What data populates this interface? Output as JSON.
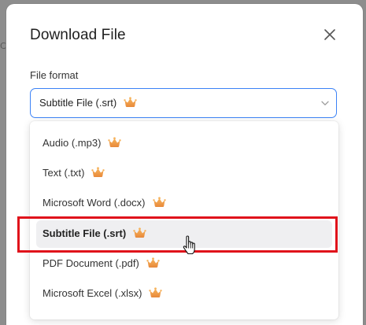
{
  "background": {
    "partial_text": "C"
  },
  "dialog": {
    "title": "Download File",
    "field_label": "File format",
    "selected_value": "Subtitle File (.srt)",
    "options": [
      {
        "label": "Audio (.mp3)",
        "premium": true,
        "selected": false
      },
      {
        "label": "Text (.txt)",
        "premium": true,
        "selected": false
      },
      {
        "label": "Microsoft Word (.docx)",
        "premium": true,
        "selected": false
      },
      {
        "label": "Subtitle File (.srt)",
        "premium": true,
        "selected": true
      },
      {
        "label": "PDF Document (.pdf)",
        "premium": true,
        "selected": false
      },
      {
        "label": "Microsoft Excel (.xlsx)",
        "premium": true,
        "selected": false
      }
    ]
  },
  "icons": {
    "close": "close-icon",
    "dropdown": "chevron-down-icon",
    "premium": "crown-icon",
    "cursor": "hand-pointer-cursor"
  },
  "colors": {
    "select_border": "#3b82f6",
    "crown_orange": "#f0a04b",
    "selected_row_bg": "#efeff1",
    "annotation_red": "#e0131b",
    "overlay": "#8d8d8d"
  }
}
